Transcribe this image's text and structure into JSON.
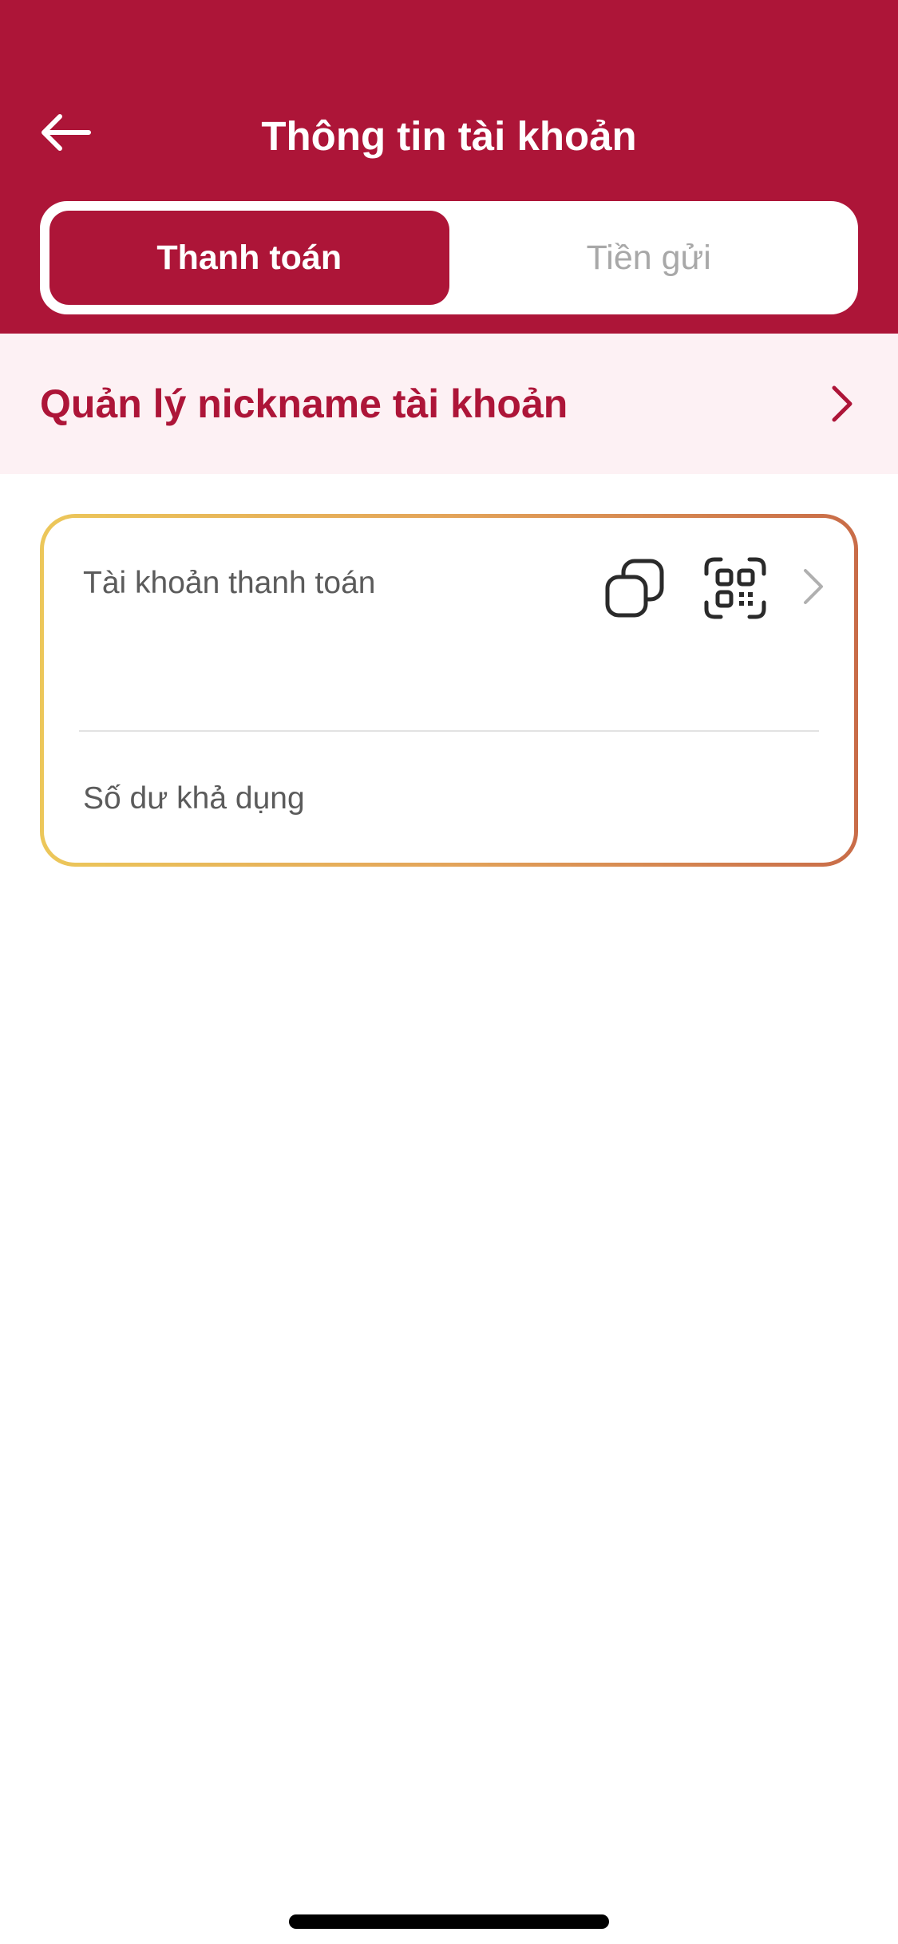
{
  "header": {
    "title": "Thông tin tài khoản",
    "back_icon": "arrow-left-icon",
    "background_color": "#ad1538"
  },
  "tabs": [
    {
      "label": "Thanh toán",
      "active": true
    },
    {
      "label": "Tiền gửi",
      "active": false
    }
  ],
  "nickname": {
    "label": "Quản lý nickname tài khoản",
    "chevron_icon": "chevron-right-icon"
  },
  "account_card": {
    "account_label": "Tài khoản thanh toán",
    "copy_icon": "copy-icon",
    "qr_icon": "qr-code-icon",
    "chevron_icon": "chevron-right-icon",
    "balance_label": "Số dư khả dụng"
  },
  "colors": {
    "accent": "#ad1538",
    "row_background": "#fdf1f4",
    "card_border_start": "#ecc75a",
    "card_border_end": "#c96c48"
  }
}
